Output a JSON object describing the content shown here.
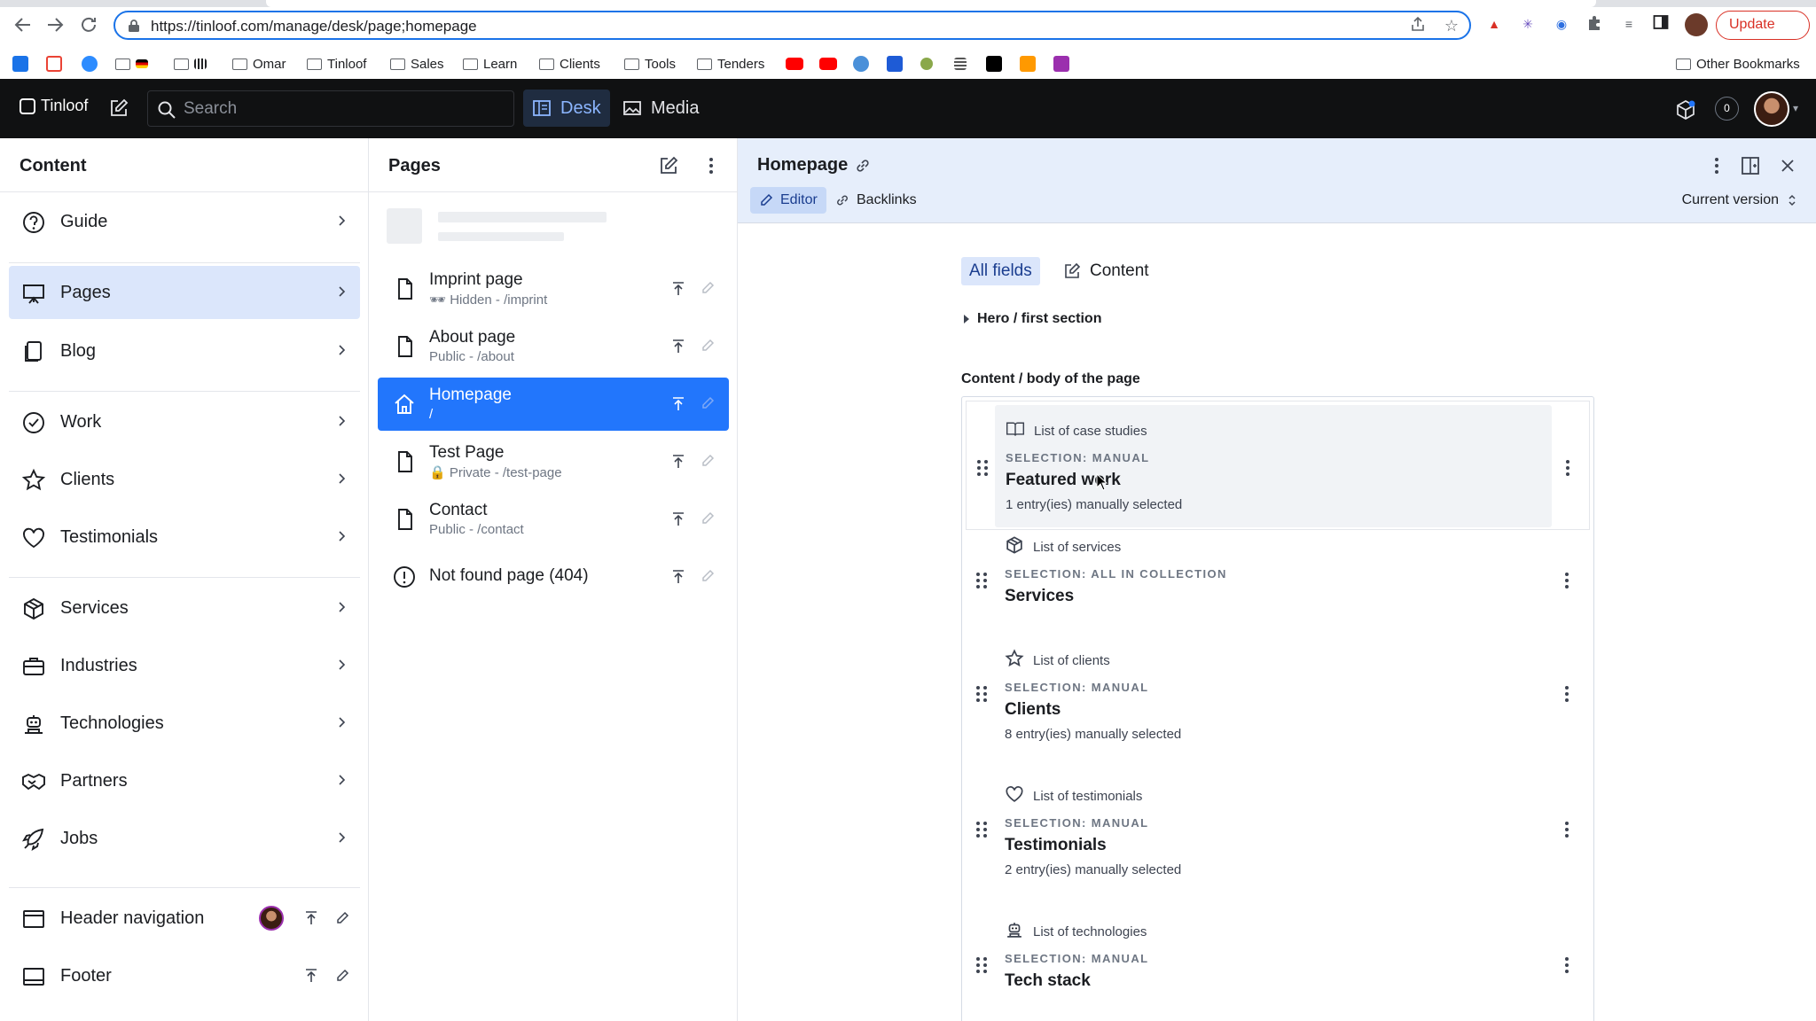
{
  "browser": {
    "url_full": "https://tinloof.com/manage/desk/page;homepage",
    "update_label": "Update",
    "bookmarks": [
      {
        "label": "",
        "type": "favicon",
        "color": "#1a73e8"
      },
      {
        "label": "",
        "type": "favicon",
        "color": "#ea4335"
      },
      {
        "label": "",
        "type": "favicon",
        "color": "#2d8cff"
      },
      {
        "label": "",
        "type": "folder"
      },
      {
        "label": "",
        "type": "folder"
      },
      {
        "label": "Omar",
        "type": "folder"
      },
      {
        "label": "Tinloof",
        "type": "folder"
      },
      {
        "label": "Sales",
        "type": "folder"
      },
      {
        "label": "Learn",
        "type": "folder"
      },
      {
        "label": "Clients",
        "type": "folder"
      },
      {
        "label": "Tools",
        "type": "folder"
      },
      {
        "label": "Tenders",
        "type": "folder"
      }
    ],
    "other_bookmarks": "Other Bookmarks"
  },
  "app": {
    "brand": "Tinloof",
    "search_placeholder": "Search",
    "tools": [
      {
        "label": "Desk",
        "active": true
      },
      {
        "label": "Media",
        "active": false
      }
    ],
    "notification_count": "0"
  },
  "content_pane": {
    "title": "Content",
    "items": [
      {
        "label": "Guide",
        "icon": "help-circle-icon"
      },
      {
        "label": "Pages",
        "icon": "presentation-icon",
        "selected": true
      },
      {
        "label": "Blog",
        "icon": "documents-icon"
      },
      {
        "label": "Work",
        "icon": "check-circle-icon"
      },
      {
        "label": "Clients",
        "icon": "star-icon"
      },
      {
        "label": "Testimonials",
        "icon": "heart-icon"
      },
      {
        "label": "Services",
        "icon": "package-icon"
      },
      {
        "label": "Industries",
        "icon": "briefcase-icon"
      },
      {
        "label": "Technologies",
        "icon": "robot-icon"
      },
      {
        "label": "Partners",
        "icon": "handshake-icon"
      },
      {
        "label": "Jobs",
        "icon": "rocket-icon"
      },
      {
        "label": "Header navigation",
        "icon": "window-icon"
      },
      {
        "label": "Footer",
        "icon": "footer-icon"
      }
    ]
  },
  "pages_pane": {
    "title": "Pages",
    "items": [
      {
        "title": "Imprint page",
        "subtitle": "🕶 Hidden - /imprint",
        "icon": "document-icon"
      },
      {
        "title": "About page",
        "subtitle": "Public - /about",
        "icon": "document-icon"
      },
      {
        "title": "Homepage",
        "subtitle": "/",
        "icon": "home-icon",
        "selected": true
      },
      {
        "title": "Test Page",
        "subtitle": "🔒 Private - /test-page",
        "icon": "document-icon"
      },
      {
        "title": "Contact",
        "subtitle": "Public - /contact",
        "icon": "document-icon"
      },
      {
        "title": "Not found page (404)",
        "subtitle": "",
        "icon": "warning-circle-icon"
      }
    ]
  },
  "document": {
    "title": "Homepage",
    "tabs": [
      {
        "label": "Editor",
        "active": true
      },
      {
        "label": "Backlinks",
        "active": false
      }
    ],
    "version_label": "Current version",
    "field_tabs": [
      {
        "label": "All fields",
        "active": true
      },
      {
        "label": "Content",
        "active": false
      }
    ],
    "fieldset": "Hero / first section",
    "section_label": "Content / body of the page",
    "blocks": [
      {
        "type": "List of case studies",
        "selection": "SELECTION: MANUAL",
        "title": "Featured work",
        "count": "1 entry(ies) manually selected",
        "icon": "book-icon"
      },
      {
        "type": "List of services",
        "selection": "SELECTION: ALL IN COLLECTION",
        "title": "Services",
        "count": "",
        "icon": "package-icon"
      },
      {
        "type": "List of clients",
        "selection": "SELECTION: MANUAL",
        "title": "Clients",
        "count": "8 entry(ies) manually selected",
        "icon": "star-icon"
      },
      {
        "type": "List of testimonials",
        "selection": "SELECTION: MANUAL",
        "title": "Testimonials",
        "count": "2 entry(ies) manually selected",
        "icon": "heart-icon"
      },
      {
        "type": "List of technologies",
        "selection": "SELECTION: MANUAL",
        "title": "Tech stack",
        "count": "",
        "icon": "robot-icon"
      }
    ]
  },
  "colors": {
    "accent": "#2276fc",
    "selected_bg": "#dbe6fb",
    "header_bg": "#101112"
  }
}
